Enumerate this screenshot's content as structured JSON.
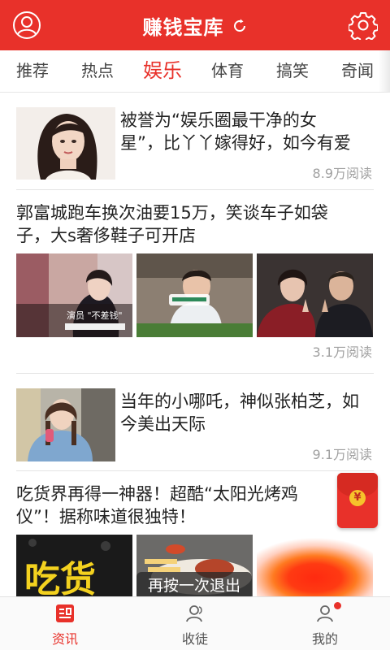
{
  "app": {
    "title": "赚钱宝库",
    "header_icons": [
      "user-circle-icon",
      "refresh-icon",
      "gear-icon"
    ]
  },
  "tabs": [
    {
      "label": "推荐",
      "active": false
    },
    {
      "label": "热点",
      "active": false
    },
    {
      "label": "娱乐",
      "active": true
    },
    {
      "label": "体育",
      "active": false
    },
    {
      "label": "搞笑",
      "active": false
    },
    {
      "label": "奇闻",
      "active": false
    }
  ],
  "feed": {
    "items": [
      {
        "title_line1": "被誉为“娱乐圈最干净的女",
        "title_line2": "星”，比丫丫嫁得好，如今有爱",
        "reads": "8.9万阅读"
      },
      {
        "title_line1": "郭富城跑车换次油要15万，笑谈车子如袋",
        "title_line2": "子，大s奢侈鞋子可开店",
        "reads": "3.1万阅读",
        "thumb1_caption": "演员 \"不差钱\""
      },
      {
        "title_line1": "当年的小哪吒，神似张柏芝，如",
        "title_line2": "今美出天际",
        "reads": "9.1万阅读"
      },
      {
        "title_line1": "吃货界再得一神器！超酷“太阳光烤鸡",
        "title_line2": "仪”！据称味道很独特！",
        "thumb1_text": "吃货"
      }
    ]
  },
  "redpack": {
    "coin_symbol": "¥"
  },
  "toast": {
    "text": "再按一次退出"
  },
  "bottom_nav": [
    {
      "label": "资讯",
      "icon": "news-icon",
      "active": true
    },
    {
      "label": "收徒",
      "icon": "apprentice-icon",
      "active": false
    },
    {
      "label": "我的",
      "icon": "profile-icon",
      "active": false,
      "badge": true
    }
  ],
  "colors": {
    "brand_red": "#e8312a",
    "text_dark": "#222222",
    "text_muted": "#a0a0a0"
  }
}
